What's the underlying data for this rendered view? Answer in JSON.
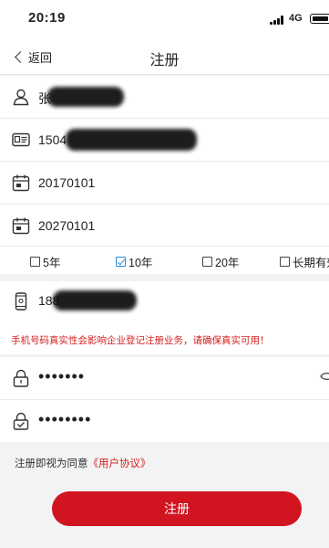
{
  "status_bar": {
    "time": "20:19",
    "network": "4G"
  },
  "nav": {
    "back_label": "返回",
    "title": "注册"
  },
  "fields": {
    "name": "张",
    "id_number": "1504",
    "start_date": "20170101",
    "end_date": "20270101",
    "phone": "188",
    "password": "•••••••",
    "confirm_password": "••••••••"
  },
  "validity_options": [
    {
      "label": "5年",
      "checked": false
    },
    {
      "label": "10年",
      "checked": true
    },
    {
      "label": "20年",
      "checked": false
    },
    {
      "label": "长期有效",
      "checked": false
    }
  ],
  "warning": "手机号码真实性会影响企业登记注册业务，请确保真实可用！",
  "agreement": {
    "prefix": "注册即视为同意",
    "link": "《用户协议》"
  },
  "submit_label": "注册",
  "colors": {
    "accent": "#d01420",
    "checkbox": "#2a8bd8",
    "warning": "#d42020"
  }
}
